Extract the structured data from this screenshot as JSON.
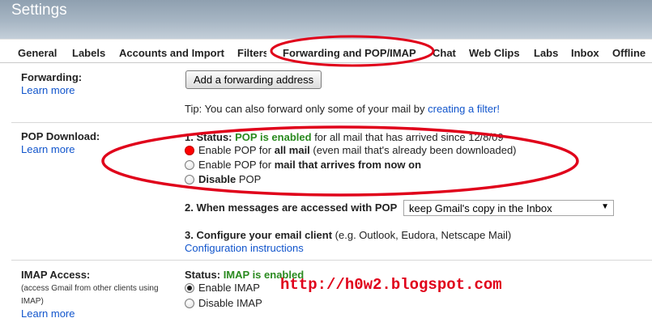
{
  "header": {
    "title": "Settings"
  },
  "tabs": [
    {
      "label": "General"
    },
    {
      "label": "Labels"
    },
    {
      "label": "Accounts and Import"
    },
    {
      "label": "Filters"
    },
    {
      "label": "Forwarding and POP/IMAP",
      "active": true
    },
    {
      "label": "Chat"
    },
    {
      "label": "Web Clips"
    },
    {
      "label": "Labs"
    },
    {
      "label": "Inbox"
    },
    {
      "label": "Offline"
    }
  ],
  "forwarding": {
    "title": "Forwarding:",
    "learn_more": "Learn more",
    "add_button": "Add a forwarding address",
    "tip_prefix": "Tip: You can also forward only some of your mail by",
    "tip_link": "creating a filter!"
  },
  "pop": {
    "title": "POP Download:",
    "learn_more": "Learn more",
    "status_label": "1. Status:",
    "status_value": "POP is enabled",
    "status_suffix": "for all mail that has arrived since 12/8/09",
    "options": [
      {
        "pre": "Enable POP for",
        "bold": "all mail",
        "post": "(even mail that's already been downloaded)",
        "selected": true
      },
      {
        "pre": "Enable POP for",
        "bold": "mail that arrives from now on",
        "post": "",
        "selected": false
      },
      {
        "pre": "",
        "bold": "Disable",
        "post": "POP",
        "selected": false
      }
    ],
    "access_label": "2. When messages are accessed with POP",
    "access_value": "keep Gmail's copy in the Inbox",
    "client_label": "3. Configure your email client",
    "client_suffix": "(e.g. Outlook, Eudora, Netscape Mail)",
    "client_link": "Configuration instructions"
  },
  "imap": {
    "title": "IMAP Access:",
    "note": "(access Gmail from other clients using IMAP)",
    "learn_more": "Learn more",
    "status_label": "Status:",
    "status_value": "IMAP is enabled",
    "options": [
      {
        "label": "Enable IMAP",
        "selected": true
      },
      {
        "label": "Disable IMAP",
        "selected": false
      }
    ]
  },
  "watermark": "http://h0w2.blogspot.com",
  "colors": {
    "accent_link": "#1155cc",
    "status_green": "#2a8a1f",
    "annotation_red": "#e0001a"
  }
}
